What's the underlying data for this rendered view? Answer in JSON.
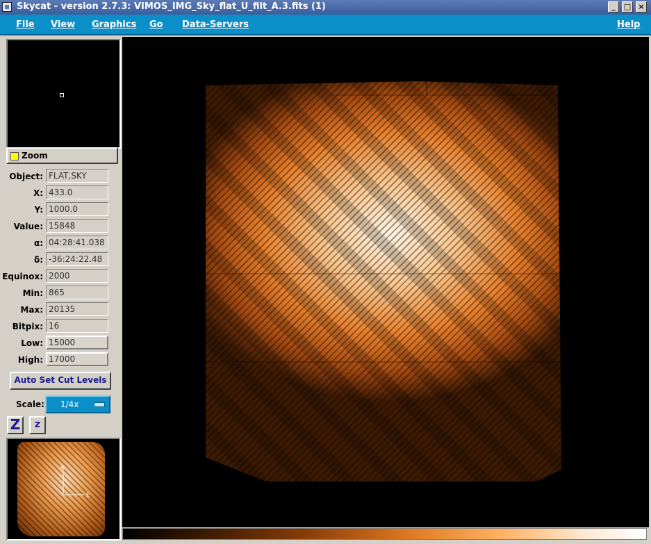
{
  "window": {
    "title": "Skycat - version 2.7.3: VIMOS_IMG_Sky_flat_U_filt_A.3.fits (1)",
    "controls": {
      "minimize": "_",
      "maximize": "□",
      "close": "×"
    }
  },
  "menubar": {
    "file": "File",
    "view": "View",
    "graphics": "Graphics",
    "go": "Go",
    "data_servers": "Data-Servers",
    "help": "Help"
  },
  "zoom": {
    "label": "Zoom",
    "checked": true
  },
  "info": {
    "object": {
      "label": "Object:",
      "value": "FLAT,SKY"
    },
    "x": {
      "label": "X:",
      "value": "433.0"
    },
    "y": {
      "label": "Y:",
      "value": "1000.0"
    },
    "value": {
      "label": "Value:",
      "value": "15848"
    },
    "alpha": {
      "label": "α:",
      "value": "04:28:41.038"
    },
    "delta": {
      "label": "δ:",
      "value": "-36:24:22.48"
    },
    "equinox": {
      "label": "Equinox:",
      "value": "2000"
    },
    "min": {
      "label": "Min:",
      "value": "865"
    },
    "max": {
      "label": "Max:",
      "value": "20135"
    },
    "bitpix": {
      "label": "Bitpix:",
      "value": "16"
    },
    "low": {
      "label": "Low:",
      "value": "15000"
    },
    "high": {
      "label": "High:",
      "value": "17000"
    }
  },
  "buttons": {
    "auto_set_cut_levels": "Auto Set Cut Levels",
    "zoom_in": "Z",
    "zoom_out": "z"
  },
  "scale": {
    "label": "Scale:",
    "value": "1/4x"
  },
  "colors": {
    "menubar": "#0a8fc8",
    "titlebar": "#3c5d9c",
    "panel": "#d4d0c8",
    "image_colormap": "orange heat"
  }
}
